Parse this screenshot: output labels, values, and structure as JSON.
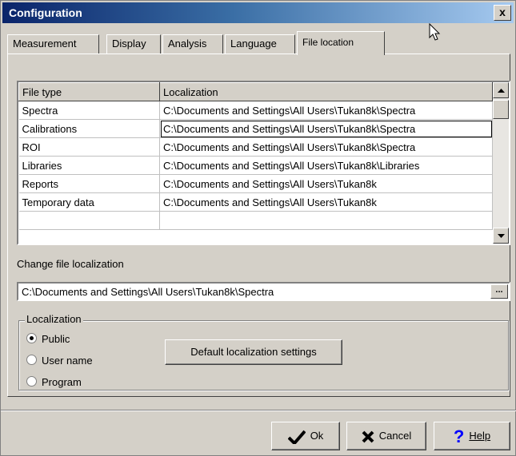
{
  "window": {
    "title": "Configuration",
    "close_label": "x"
  },
  "tabs": [
    {
      "label": "Measurement"
    },
    {
      "label": "Display"
    },
    {
      "label": "Analysis"
    },
    {
      "label": "Language"
    },
    {
      "label": "File location",
      "active": true
    }
  ],
  "grid": {
    "headers": [
      "File type",
      "Localization"
    ],
    "rows": [
      [
        "Spectra",
        "C:\\Documents and Settings\\All Users\\Tukan8k\\Spectra"
      ],
      [
        "Calibrations",
        "C:\\Documents and Settings\\All Users\\Tukan8k\\Spectra"
      ],
      [
        "ROI",
        "C:\\Documents and Settings\\All Users\\Tukan8k\\Spectra"
      ],
      [
        "Libraries",
        "C:\\Documents and Settings\\All Users\\Tukan8k\\Libraries"
      ],
      [
        "Reports",
        "C:\\Documents and Settings\\All Users\\Tukan8k"
      ],
      [
        "Temporary data",
        "C:\\Documents and Settings\\All Users\\Tukan8k"
      ],
      [
        "",
        ""
      ]
    ],
    "selected_row": 1
  },
  "change": {
    "label": "Change file localization",
    "value": "C:\\Documents and Settings\\All Users\\Tukan8k\\Spectra",
    "browse_label": "..."
  },
  "localization": {
    "title": "Localization",
    "options": [
      "Public",
      "User name",
      "Program"
    ],
    "selected": 0,
    "default_button": "Default localization settings"
  },
  "buttons": {
    "ok": "Ok",
    "cancel": "Cancel",
    "help": "Help"
  },
  "colors": {
    "title_start": "#0a246a",
    "title_end": "#a6caf0",
    "face": "#d4d0c8",
    "help_icon": "#0000ff"
  }
}
